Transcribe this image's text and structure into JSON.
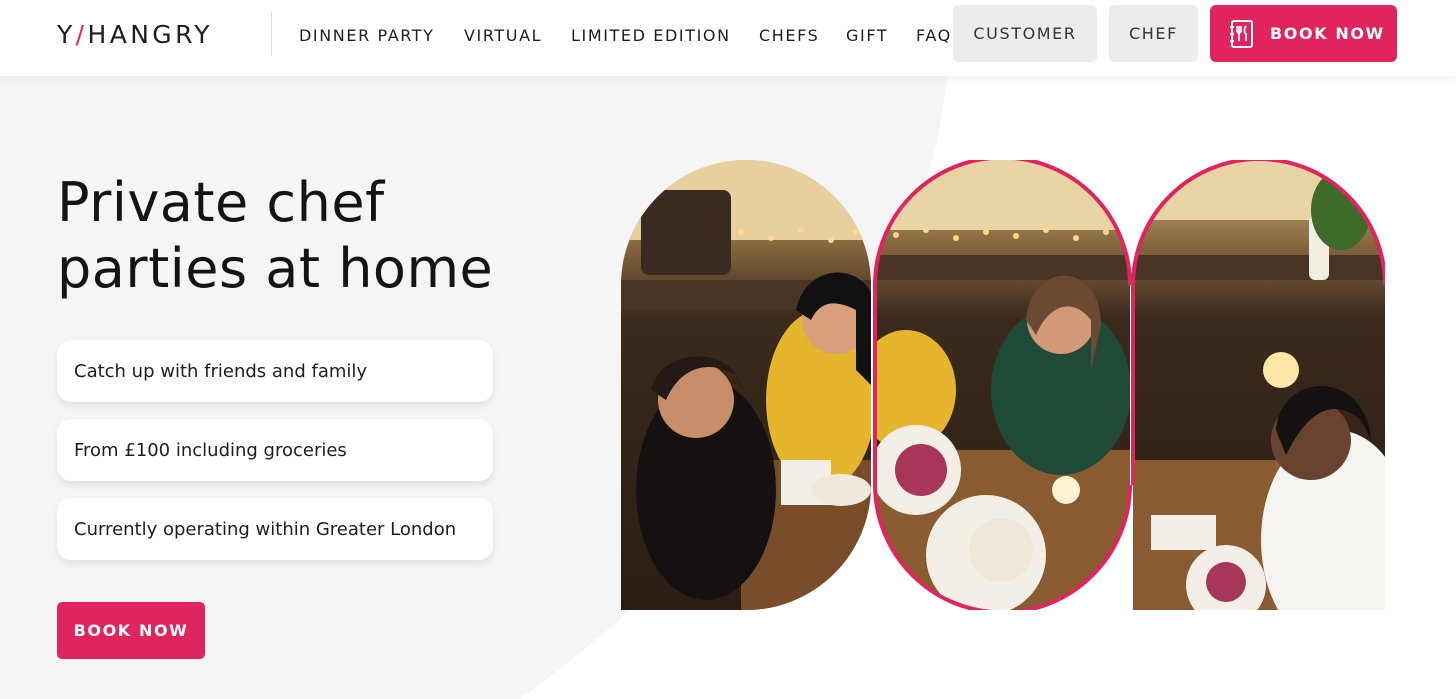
{
  "brand": {
    "logo_left": "Y",
    "logo_slash": "/",
    "logo_right": "HANGRY",
    "accent_color": "#e0245e"
  },
  "nav": {
    "links": [
      "DINNER PARTY",
      "VIRTUAL",
      "LIMITED EDITION",
      "CHEFS",
      "GIFT",
      "FAQ"
    ]
  },
  "header_buttons": {
    "customer": "CUSTOMER",
    "chef": "CHEF",
    "book_now": "BOOK NOW",
    "book_icon": "menu-card-icon"
  },
  "hero": {
    "title_line1": "Private chef",
    "title_line2": "parties at home",
    "features": [
      "Catch up with friends and family",
      "From £100 including groceries",
      "Currently operating within Greater London"
    ],
    "cta": "BOOK NOW",
    "image_description": "friends-dinner-party-photo"
  }
}
